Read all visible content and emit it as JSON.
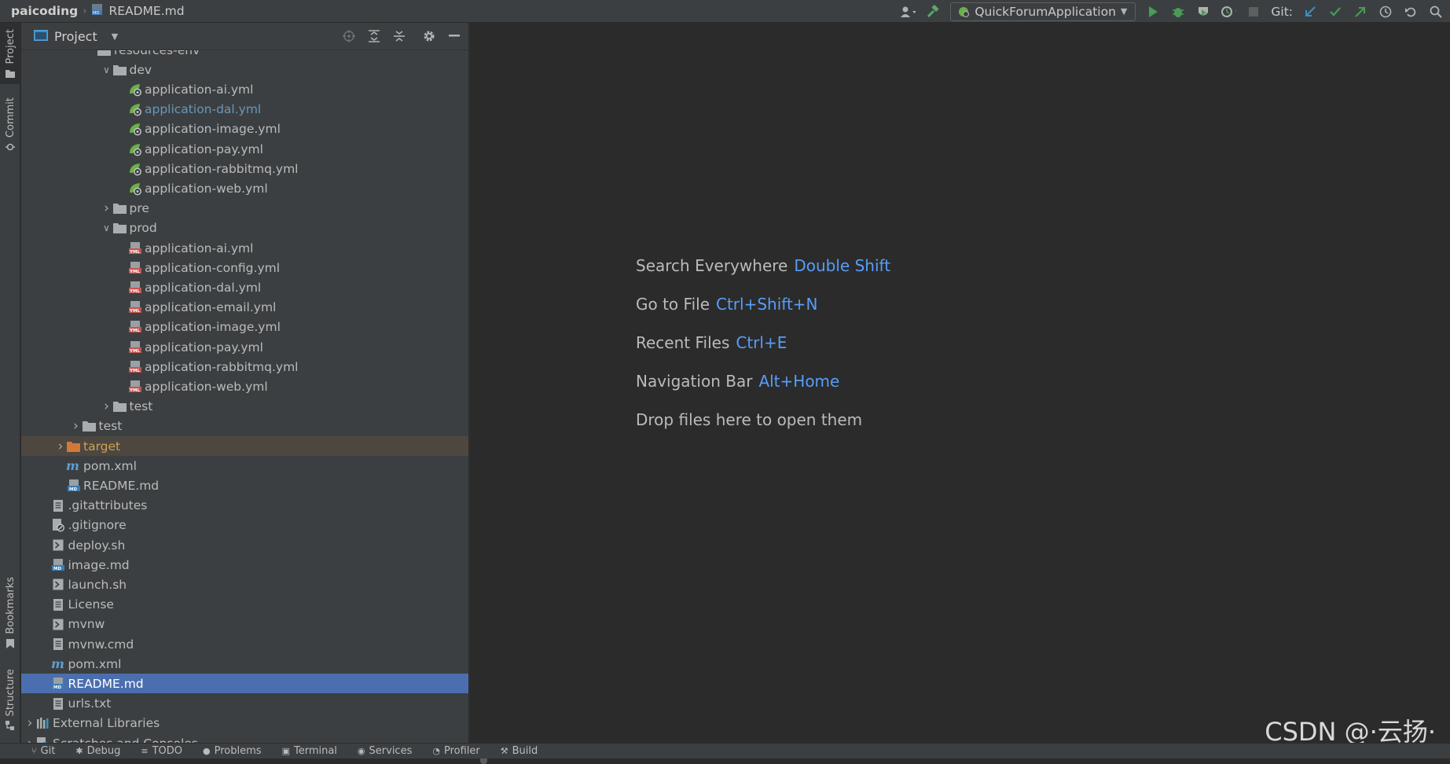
{
  "topbar": {
    "project": "paicoding",
    "file": "README.md",
    "run_config": "QuickForumApplication",
    "git_label": "Git:"
  },
  "left_strip": {
    "project": "Project",
    "commit": "Commit",
    "bookmarks": "Bookmarks",
    "structure": "Structure"
  },
  "panel": {
    "title": "Project"
  },
  "tree": [
    {
      "label": "resources-env",
      "depth": 4,
      "icon": "folder",
      "arrow": "",
      "style": "partial"
    },
    {
      "label": "dev",
      "depth": 5,
      "icon": "folder",
      "arrow": "down"
    },
    {
      "label": "application-ai.yml",
      "depth": 6,
      "icon": "spring-yml"
    },
    {
      "label": "application-dal.yml",
      "depth": 6,
      "icon": "spring-yml",
      "style": "blue"
    },
    {
      "label": "application-image.yml",
      "depth": 6,
      "icon": "spring-yml"
    },
    {
      "label": "application-pay.yml",
      "depth": 6,
      "icon": "spring-yml"
    },
    {
      "label": "application-rabbitmq.yml",
      "depth": 6,
      "icon": "spring-yml"
    },
    {
      "label": "application-web.yml",
      "depth": 6,
      "icon": "spring-yml"
    },
    {
      "label": "pre",
      "depth": 5,
      "icon": "folder",
      "arrow": "right"
    },
    {
      "label": "prod",
      "depth": 5,
      "icon": "folder",
      "arrow": "down"
    },
    {
      "label": "application-ai.yml",
      "depth": 6,
      "icon": "yml"
    },
    {
      "label": "application-config.yml",
      "depth": 6,
      "icon": "yml"
    },
    {
      "label": "application-dal.yml",
      "depth": 6,
      "icon": "yml"
    },
    {
      "label": "application-email.yml",
      "depth": 6,
      "icon": "yml"
    },
    {
      "label": "application-image.yml",
      "depth": 6,
      "icon": "yml"
    },
    {
      "label": "application-pay.yml",
      "depth": 6,
      "icon": "yml"
    },
    {
      "label": "application-rabbitmq.yml",
      "depth": 6,
      "icon": "yml"
    },
    {
      "label": "application-web.yml",
      "depth": 6,
      "icon": "yml"
    },
    {
      "label": "test",
      "depth": 5,
      "icon": "folder",
      "arrow": "right"
    },
    {
      "label": "test",
      "depth": 3,
      "icon": "folder",
      "arrow": "right"
    },
    {
      "label": "target",
      "depth": 2,
      "icon": "folder-orange",
      "arrow": "right",
      "style": "orange"
    },
    {
      "label": "pom.xml",
      "depth": 2,
      "icon": "maven"
    },
    {
      "label": "README.md",
      "depth": 2,
      "icon": "md"
    },
    {
      "label": ".gitattributes",
      "depth": 1,
      "icon": "file"
    },
    {
      "label": ".gitignore",
      "depth": 1,
      "icon": "gitignore"
    },
    {
      "label": "deploy.sh",
      "depth": 1,
      "icon": "shell"
    },
    {
      "label": "image.md",
      "depth": 1,
      "icon": "md"
    },
    {
      "label": "launch.sh",
      "depth": 1,
      "icon": "shell"
    },
    {
      "label": "License",
      "depth": 1,
      "icon": "file"
    },
    {
      "label": "mvnw",
      "depth": 1,
      "icon": "shell"
    },
    {
      "label": "mvnw.cmd",
      "depth": 1,
      "icon": "file"
    },
    {
      "label": "pom.xml",
      "depth": 1,
      "icon": "maven"
    },
    {
      "label": "README.md",
      "depth": 1,
      "icon": "md",
      "style": "selected"
    },
    {
      "label": "urls.txt",
      "depth": 1,
      "icon": "file"
    },
    {
      "label": "External Libraries",
      "depth": 0,
      "icon": "libraries",
      "arrow": "right"
    },
    {
      "label": "Scratches and Consoles",
      "depth": 0,
      "icon": "scratches",
      "arrow": "right"
    }
  ],
  "hints": [
    {
      "text": "Search Everywhere",
      "key": "Double Shift"
    },
    {
      "text": "Go to File",
      "key": "Ctrl+Shift+N"
    },
    {
      "text": "Recent Files",
      "key": "Ctrl+E"
    },
    {
      "text": "Navigation Bar",
      "key": "Alt+Home"
    },
    {
      "text": "Drop files here to open them",
      "key": ""
    }
  ],
  "bottom_tabs": [
    "Git",
    "Debug",
    "TODO",
    "Problems",
    "Terminal",
    "Services",
    "Profiler",
    "Build"
  ],
  "watermark": "CSDN @·云扬·"
}
